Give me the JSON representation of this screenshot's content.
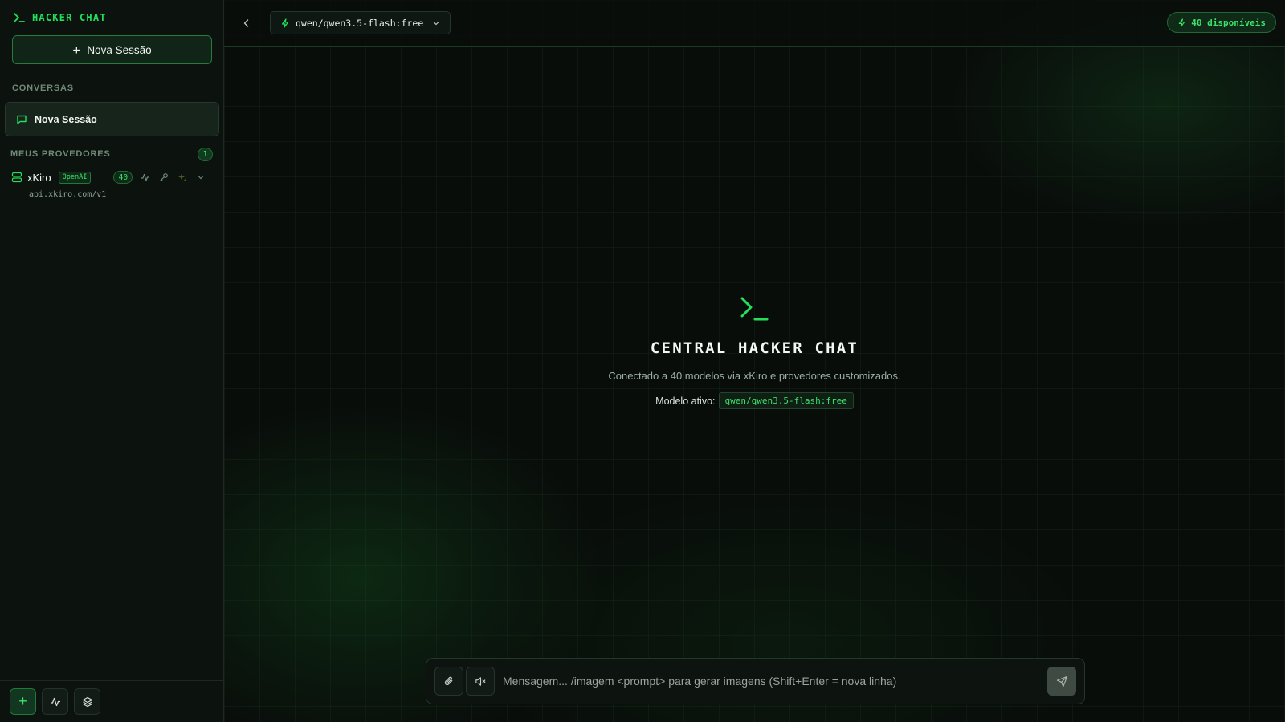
{
  "colors": {
    "accent": "#22e05a",
    "background": "#090d0a",
    "sidebar_bg": "#0c120e",
    "muted": "#6f8a77"
  },
  "sidebar": {
    "brand": "HACKER CHAT",
    "new_session_label": "Nova Sessão",
    "conversations_heading": "CONVERSAS",
    "conversations": [
      {
        "label": "Nova Sessão",
        "icon": "chat-bubble-icon"
      }
    ],
    "providers_heading": "MEUS PROVEDORES",
    "providers_count": "1",
    "providers": [
      {
        "name": "xKiro",
        "type": "OpenAI",
        "model_count": "40",
        "url": "api.xkiro.com/v1",
        "icons": [
          "server-icon",
          "activity-icon",
          "key-icon",
          "sparkles-icon",
          "chevron-down-icon"
        ]
      }
    ],
    "footer_icons": [
      "plus-icon",
      "activity-icon",
      "layers-icon"
    ]
  },
  "header": {
    "selected_model": "qwen/qwen3.5-flash:free",
    "available_badge": "40 disponíveis"
  },
  "main": {
    "title": "CENTRAL HACKER CHAT",
    "subtitle": "Conectado a 40 modelos via xKiro e provedores customizados.",
    "active_model_label": "Modelo ativo:",
    "active_model_value": "qwen/qwen3.5-flash:free"
  },
  "composer": {
    "placeholder": "Mensagem... /imagem <prompt> para gerar imagens (Shift+Enter = nova linha)",
    "value": ""
  }
}
